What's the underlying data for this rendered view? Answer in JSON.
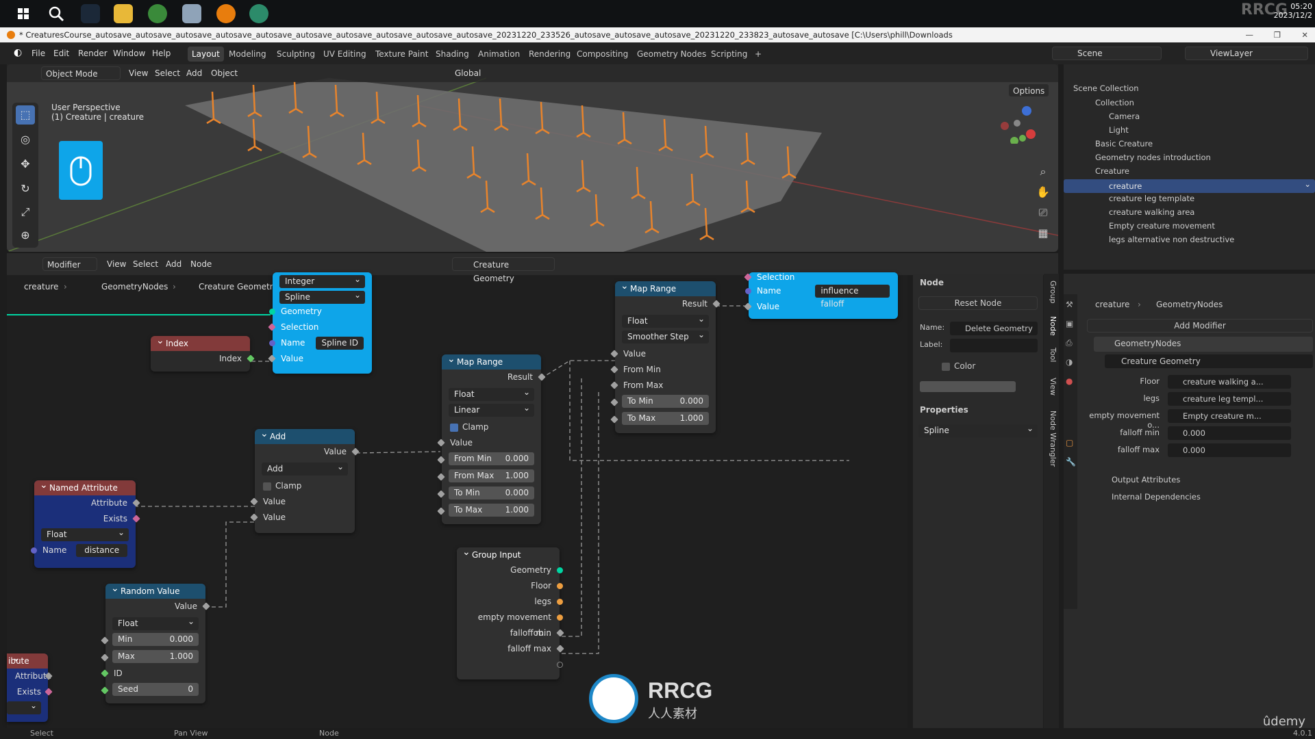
{
  "taskbar": {
    "clock_time": "05:20",
    "clock_date": "2023/12/2",
    "watermark": "RRCG"
  },
  "titlebar": {
    "title": "* CreaturesCourse_autosave_autosave_autosave_autosave_autosave_autosave_autosave_autosave_autosave_autosave_20231220_233526_autosave_autosave_autosave_20231220_233823_autosave_autosave [C:\\Users\\phill\\Downloads"
  },
  "menus": [
    "File",
    "Edit",
    "Render",
    "Window",
    "Help"
  ],
  "workspaces": [
    "Layout",
    "Modeling",
    "Sculpting",
    "UV Editing",
    "Texture Paint",
    "Shading",
    "Animation",
    "Rendering",
    "Compositing",
    "Geometry Nodes",
    "Scripting",
    "+"
  ],
  "active_workspace": "Layout",
  "scene": {
    "label": "Scene",
    "view_layer": "ViewLayer"
  },
  "viewport": {
    "mode": "Object Mode",
    "menus": [
      "View",
      "Select",
      "Add",
      "Object"
    ],
    "transform": "Global",
    "options": "Options",
    "perspective": "User Perspective",
    "active_object": "(1) Creature | creature"
  },
  "outliner": {
    "root": "Scene Collection",
    "items": [
      {
        "name": "Collection",
        "level": 1
      },
      {
        "name": "Camera",
        "level": 2
      },
      {
        "name": "Light",
        "level": 2
      },
      {
        "name": "Basic Creature",
        "level": 1
      },
      {
        "name": "Geometry nodes introduction",
        "level": 1
      },
      {
        "name": "Creature",
        "level": 1
      },
      {
        "name": "creature",
        "level": 2
      },
      {
        "name": "creature leg template",
        "level": 2
      },
      {
        "name": "creature walking area",
        "level": 2
      },
      {
        "name": "Empty creature movement",
        "level": 2
      },
      {
        "name": "legs alternative non destructive",
        "level": 2
      }
    ]
  },
  "node_editor": {
    "mode": "Modifier",
    "menus": [
      "View",
      "Select",
      "Add",
      "Node"
    ],
    "tree_name": "Creature Geometry",
    "breadcrumb": [
      "creature",
      "GeometryNodes",
      "Creature Geometry"
    ]
  },
  "nodes": {
    "store": {
      "type1": "Integer",
      "type2": "Spline",
      "geometry": "Geometry",
      "selection": "Selection",
      "name_label": "Name",
      "name_value": "Spline ID",
      "value": "Value"
    },
    "index": {
      "title": "Index",
      "out": "Index"
    },
    "named_attr": {
      "title": "Named Attribute",
      "attribute": "Attribute",
      "exists": "Exists",
      "type": "Float",
      "name_label": "Name",
      "name_value": "distance"
    },
    "add": {
      "title": "Add",
      "out": "Value",
      "op": "Add",
      "clamp": "Clamp",
      "in1": "Value",
      "in2": "Value"
    },
    "random": {
      "title": "Random Value",
      "out": "Value",
      "type": "Float",
      "min_label": "Min",
      "min": "0.000",
      "max_label": "Max",
      "max": "1.000",
      "id": "ID",
      "seed_label": "Seed",
      "seed": "0"
    },
    "map1": {
      "title": "Map Range",
      "out": "Result",
      "type": "Float",
      "interp": "Linear",
      "clamp": "Clamp",
      "value": "Value",
      "from_min_label": "From Min",
      "from_min": "0.000",
      "from_max_label": "From Max",
      "from_max": "1.000",
      "to_min_label": "To Min",
      "to_min": "0.000",
      "to_max_label": "To Max",
      "to_max": "1.000"
    },
    "map2": {
      "title": "Map Range",
      "out": "Result",
      "type": "Float",
      "interp": "Smoother Step",
      "value": "Value",
      "from_min": "From Min",
      "from_max": "From Max",
      "to_min_label": "To Min",
      "to_min": "0.000",
      "to_max_label": "To Max",
      "to_max": "1.000"
    },
    "store2": {
      "selection": "Selection",
      "name_label": "Name",
      "name_value": "influence falloff",
      "value": "Value"
    },
    "group_input": {
      "title": "Group Input",
      "outputs": [
        "Geometry",
        "Floor",
        "legs",
        "empty movement ob...",
        "falloff min",
        "falloff max"
      ]
    },
    "partial": {
      "title": "ibute",
      "attribute": "Attribute",
      "exists": "Exists"
    }
  },
  "node_sidebar": {
    "section": "Node",
    "reset": "Reset Node",
    "name_label": "Name:",
    "name_value": "Delete Geometry",
    "label_label": "Label:",
    "color": "Color",
    "properties": "Properties",
    "domain": "Spline",
    "tabs": [
      "Group",
      "Node",
      "Tool",
      "View",
      "Node Wrangler"
    ]
  },
  "properties": {
    "object": "creature",
    "modifier_path": "GeometryNodes",
    "add_modifier": "Add Modifier",
    "modifier_name": "GeometryNodes",
    "node_group": "Creature Geometry",
    "inputs": [
      {
        "label": "Floor",
        "value": "creature walking a..."
      },
      {
        "label": "legs",
        "value": "creature leg templ..."
      },
      {
        "label": "empty movement o...",
        "value": "Empty creature m..."
      },
      {
        "label": "falloff min",
        "value": "0.000"
      },
      {
        "label": "falloff max",
        "value": "0.000"
      }
    ],
    "output_attributes": "Output Attributes",
    "internal_dependencies": "Internal Dependencies"
  },
  "statusbar": {
    "select": "Select",
    "pan": "Pan View",
    "node": "Node",
    "version": "4.0.1"
  },
  "watermarks": {
    "center": "RRCG",
    "center_sub": "人人素材",
    "udemy": "ûdemy"
  }
}
